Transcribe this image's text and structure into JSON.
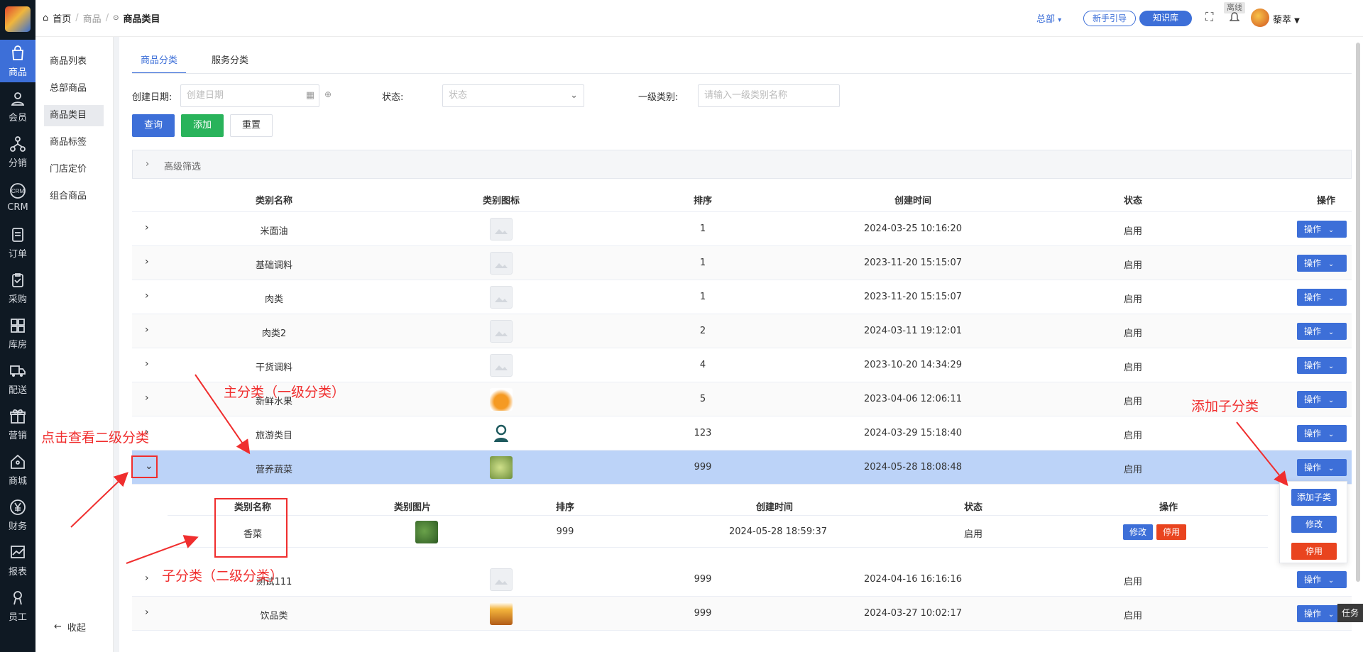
{
  "rail": {
    "items": [
      {
        "label": "商品",
        "icon": "bag-icon",
        "active": true
      },
      {
        "label": "会员",
        "icon": "user-icon"
      },
      {
        "label": "分销",
        "icon": "network-icon"
      },
      {
        "label": "CRM",
        "icon": "crm-icon"
      },
      {
        "label": "订单",
        "icon": "order-icon"
      },
      {
        "label": "采购",
        "icon": "clipboard-icon"
      },
      {
        "label": "库房",
        "icon": "warehouse-icon"
      },
      {
        "label": "配送",
        "icon": "truck-icon"
      },
      {
        "label": "营销",
        "icon": "gift-icon"
      },
      {
        "label": "商城",
        "icon": "store-icon"
      },
      {
        "label": "财务",
        "icon": "yen-icon"
      },
      {
        "label": "报表",
        "icon": "chart-icon"
      },
      {
        "label": "员工",
        "icon": "staff-icon"
      }
    ]
  },
  "breadcrumb": {
    "home": "首页",
    "mid": "商品",
    "current": "商品类目"
  },
  "topbar": {
    "org": "总部",
    "guide": "新手引导",
    "kb": "知识库",
    "offline": "离线",
    "username": "藜萃"
  },
  "subnav": {
    "items": [
      "商品列表",
      "总部商品",
      "商品类目",
      "商品标签",
      "门店定价",
      "组合商品"
    ],
    "active_index": 2,
    "collapse": "收起"
  },
  "tabs": [
    "商品分类",
    "服务分类"
  ],
  "filters": {
    "date_label": "创建日期:",
    "date_placeholder": "创建日期",
    "status_label": "状态:",
    "status_placeholder": "状态",
    "cat_label": "一级类别:",
    "cat_placeholder": "请输入一级类别名称"
  },
  "buttons": {
    "query": "查询",
    "add": "添加",
    "reset": "重置"
  },
  "advanced": "高级筛选",
  "table": {
    "headers": [
      "类别名称",
      "类别图标",
      "排序",
      "创建时间",
      "状态",
      "操作"
    ],
    "op_label": "操作",
    "rows": [
      {
        "name": "米面油",
        "sort": "1",
        "time": "2024-03-25 10:16:20",
        "status": "启用",
        "img": "placeholder"
      },
      {
        "name": "基础调料",
        "sort": "1",
        "time": "2023-11-20 15:15:07",
        "status": "启用",
        "img": "placeholder"
      },
      {
        "name": "肉类",
        "sort": "1",
        "time": "2023-11-20 15:15:07",
        "status": "启用",
        "img": "placeholder"
      },
      {
        "name": "肉类2",
        "sort": "2",
        "time": "2024-03-11 19:12:01",
        "status": "启用",
        "img": "placeholder"
      },
      {
        "name": "干货调料",
        "sort": "4",
        "time": "2023-10-20 14:34:29",
        "status": "启用",
        "img": "placeholder"
      },
      {
        "name": "新鲜水果",
        "sort": "5",
        "time": "2023-04-06 12:06:11",
        "status": "启用",
        "img": "fruit"
      },
      {
        "name": "旅游类目",
        "sort": "123",
        "time": "2024-03-29 15:18:40",
        "status": "启用",
        "img": "person"
      },
      {
        "name": "营养蔬菜",
        "sort": "999",
        "time": "2024-05-28 18:08:48",
        "status": "启用",
        "img": "veg"
      },
      {
        "name": "测试111",
        "sort": "999",
        "time": "2024-04-16 16:16:16",
        "status": "启用",
        "img": "placeholder"
      },
      {
        "name": "饮品类",
        "sort": "999",
        "time": "2024-03-27 10:02:17",
        "status": "启用",
        "img": "drink"
      }
    ]
  },
  "subtable": {
    "headers": [
      "类别名称",
      "类别图片",
      "排序",
      "创建时间",
      "状态",
      "操作"
    ],
    "row": {
      "name": "香菜",
      "sort": "999",
      "time": "2024-05-28 18:59:37",
      "status": "启用",
      "edit": "修改",
      "disable": "停用"
    }
  },
  "dropdown": {
    "add_child": "添加子类",
    "edit": "修改",
    "disable": "停用"
  },
  "annotations": {
    "main_cat": "主分类（一级分类）",
    "click_view": "点击查看二级分类",
    "add_child": "添加子分类",
    "sub_cat": "子分类（二级分类）"
  },
  "task": "任务",
  "colors": {
    "primary": "#3d6fd8",
    "success": "#29b35b",
    "danger": "#e9441f",
    "annotation": "#f02e2e",
    "highlight_row": "#bcd3f8",
    "rail_bg": "#0f1923"
  }
}
